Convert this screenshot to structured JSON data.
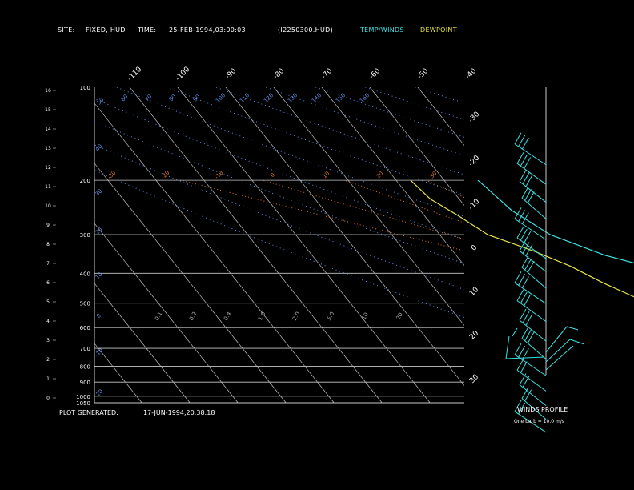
{
  "header": {
    "site_label": "SITE:",
    "site_value": "FIXED, HUD",
    "time_label": "TIME:",
    "time_value": "25-FEB-1994,03:00:03",
    "file_id": "(I2250300.HUD)",
    "legend_temp_winds": "TEMP/WINDS",
    "legend_dewpoint": "DEWPOINT"
  },
  "footer": {
    "generated_label": "PLOT GENERATED:",
    "generated_value": "17-JUN-1994,20:38:18",
    "winds_profile_title": "WINDS PROFILE",
    "barb_note": "One barb = 10.0 m/s"
  },
  "colors": {
    "background": "#000000",
    "grid": "#c8c8c8",
    "temperature_wind": "#3fe0e0",
    "dewpoint": "#e6e64a",
    "dry_adiabat": "#5f8fe6",
    "moist_adiabat": "#e07830"
  },
  "chart_data": {
    "type": "line",
    "title": "",
    "ylabel_left_km": "",
    "y_pressure_ticks": [
      "100",
      "200",
      "300",
      "400",
      "500",
      "600",
      "700",
      "800",
      "900",
      "1000",
      "1050"
    ],
    "y_pressure_values": [
      100,
      200,
      300,
      400,
      500,
      600,
      700,
      800,
      900,
      1000,
      1050
    ],
    "y_height_ticks": [
      "16",
      "15",
      "14",
      "13",
      "12",
      "11",
      "10",
      "9",
      "8",
      "7",
      "6",
      "5",
      "4",
      "3",
      "2",
      "1",
      "0"
    ],
    "top_isotherm_labels": [
      "-110",
      "-100",
      "-90",
      "-80",
      "-70",
      "-60",
      "-50",
      "-40"
    ],
    "right_isotherm_labels": [
      "-30",
      "-20",
      "-10",
      "0",
      "10",
      "20",
      "30"
    ],
    "dry_adiabat_labels": [
      "50",
      "60",
      "70",
      "80",
      "90",
      "100",
      "110",
      "120",
      "130",
      "140",
      "150",
      "160"
    ],
    "moist_adiabat_labels": [
      "-30",
      "-20",
      "-10",
      "0",
      "10",
      "20",
      "30"
    ],
    "mixing_ratio_labels": [
      "0.1",
      "0.2",
      "0.4",
      "1.0",
      "2.0",
      "5.0",
      "10",
      "20"
    ],
    "series": [
      {
        "name": "TEMP/WINDS",
        "temp_c": [
          -53,
          -52.5,
          -51,
          -47,
          -39,
          -28,
          -23,
          -23.5,
          -16,
          -7,
          -1,
          -9,
          -11
        ],
        "pressure_hpa": [
          200,
          210,
          250,
          300,
          350,
          400,
          450,
          500,
          600,
          700,
          750,
          800,
          830
        ]
      },
      {
        "name": "DEWPOINT",
        "temp_c": [
          -67,
          -66,
          -63,
          -60,
          -53,
          -48,
          -44,
          -38,
          -30,
          -25,
          -20,
          -23,
          -22,
          -30,
          -30
        ],
        "pressure_hpa": [
          200,
          230,
          260,
          300,
          340,
          380,
          430,
          500,
          550,
          600,
          700,
          750,
          800,
          820,
          830
        ]
      }
    ],
    "wind_profile": {
      "pressure_hpa": [
        160,
        180,
        200,
        220,
        250,
        280,
        300,
        330,
        360,
        400,
        450,
        500,
        550,
        600,
        650,
        700,
        750
      ],
      "barbs": [
        3,
        3,
        3,
        3,
        3,
        3,
        3,
        3,
        3,
        3,
        3,
        3,
        3,
        2,
        2,
        2,
        2
      ]
    }
  }
}
